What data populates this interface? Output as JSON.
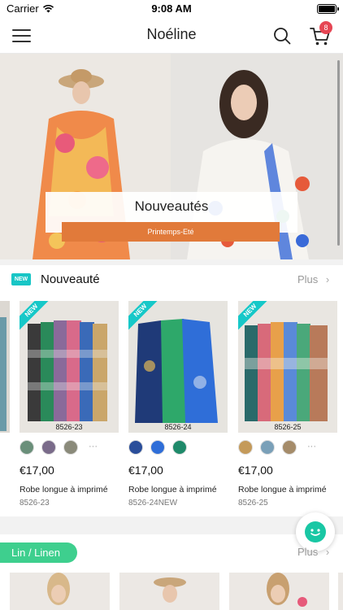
{
  "status_bar": {
    "carrier": "Carrier",
    "time": "9:08 AM"
  },
  "nav": {
    "title": "Noéline",
    "cart_count": "8",
    "icons": [
      "menu-icon",
      "search-icon",
      "cart-icon"
    ]
  },
  "banner": {
    "title": "Nouveautés",
    "button_label": "Printemps-Eté"
  },
  "section_new": {
    "badge": "NEW",
    "title": "Nouveauté",
    "more_label": "Plus",
    "ribbon": "NEW"
  },
  "products": [
    {
      "code": "8526-23",
      "price": "€17,00",
      "name": "Robe longue à imprimé",
      "sku": "8526-23",
      "colors": [
        "#6a8f7a",
        "#7a6b8a",
        "#8a8a7a"
      ]
    },
    {
      "code": "8526-24",
      "price": "€17,00",
      "name": "Robe longue à imprimé",
      "sku": "8526-24NEW",
      "colors": [
        "#2a4e9a",
        "#2f6ed8",
        "#1f8a6a"
      ]
    },
    {
      "code": "8526-25",
      "price": "€17,00",
      "name": "Robe longue à imprimé",
      "sku": "8526-25",
      "colors": [
        "#c49a5a",
        "#7aa0b8",
        "#a58c6a"
      ]
    }
  ],
  "section_lin": {
    "title": "Lin / Linen",
    "more_label": "Plus"
  },
  "colors": {
    "accent_teal": "#18c6c6",
    "accent_orange": "#e17a3a",
    "badge_red": "#e64654",
    "lin_green": "#3ecf8e",
    "chat_green": "#19c7a4"
  }
}
